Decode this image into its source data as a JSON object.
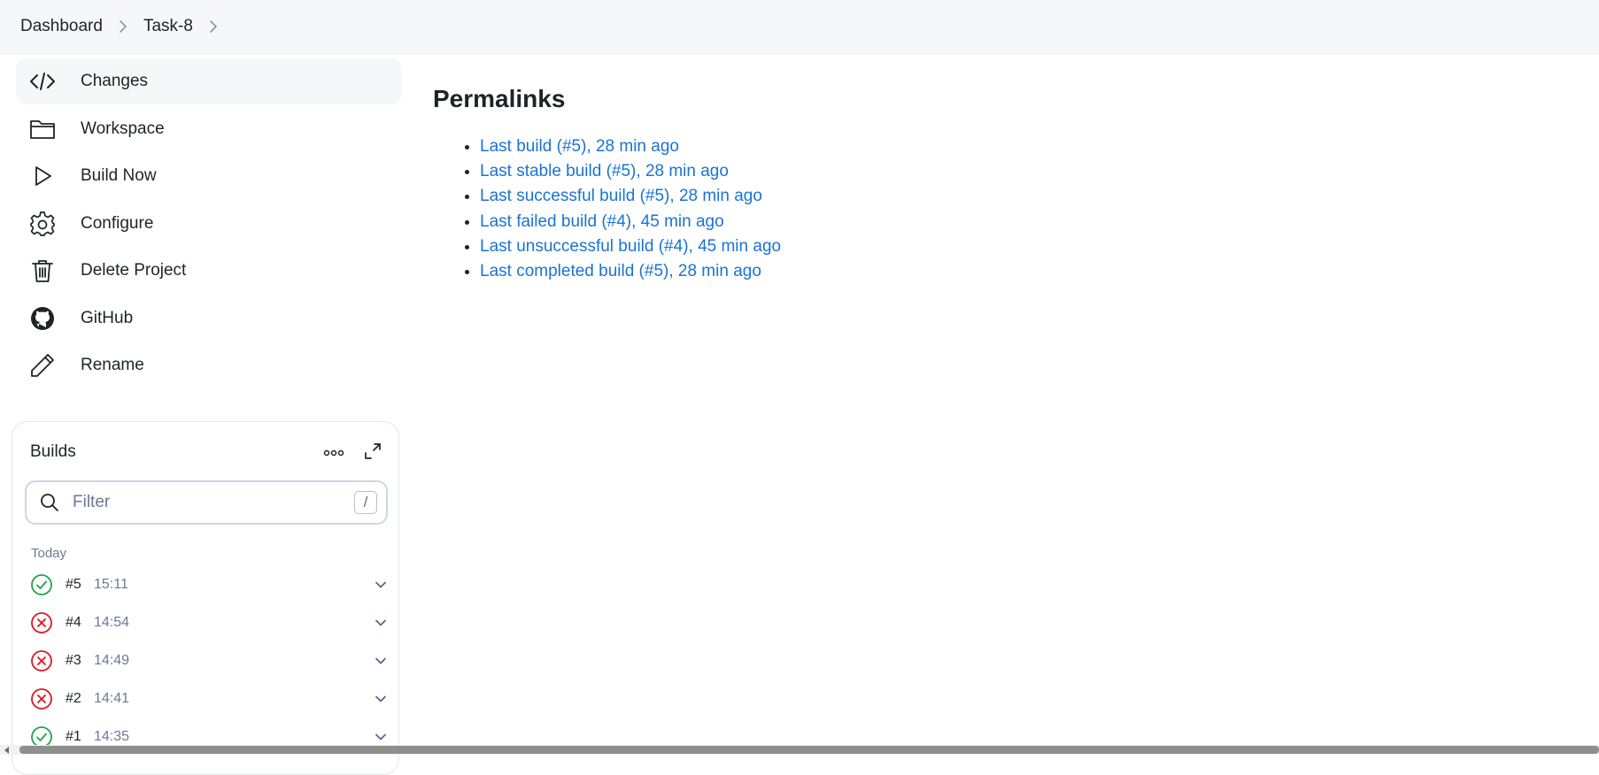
{
  "breadcrumb": {
    "items": [
      "Dashboard",
      "Task-8"
    ]
  },
  "sidemenu": {
    "items": [
      {
        "label": "Changes",
        "icon": "code-icon"
      },
      {
        "label": "Workspace",
        "icon": "folder-icon"
      },
      {
        "label": "Build Now",
        "icon": "play-icon"
      },
      {
        "label": "Configure",
        "icon": "gear-icon"
      },
      {
        "label": "Delete Project",
        "icon": "trash-icon"
      },
      {
        "label": "GitHub",
        "icon": "github-icon"
      },
      {
        "label": "Rename",
        "icon": "pencil-icon"
      }
    ]
  },
  "builds": {
    "title": "Builds",
    "filter_placeholder": "Filter",
    "filter_shortcut": "/",
    "group_label": "Today",
    "rows": [
      {
        "number": "#5",
        "time": "15:11",
        "status": "success"
      },
      {
        "number": "#4",
        "time": "14:54",
        "status": "failed"
      },
      {
        "number": "#3",
        "time": "14:49",
        "status": "failed"
      },
      {
        "number": "#2",
        "time": "14:41",
        "status": "failed"
      },
      {
        "number": "#1",
        "time": "14:35",
        "status": "success"
      }
    ]
  },
  "main": {
    "title": "Permalinks",
    "links": [
      "Last build (#5), 28 min ago",
      "Last stable build (#5), 28 min ago",
      "Last successful build (#5), 28 min ago",
      "Last failed build (#4), 45 min ago",
      "Last unsuccessful build (#4), 45 min ago",
      "Last completed build (#5), 28 min ago"
    ]
  },
  "colors": {
    "link": "#1a73d4",
    "success": "#1ea446",
    "failed": "#e0141e",
    "muted": "#6a7a92"
  }
}
